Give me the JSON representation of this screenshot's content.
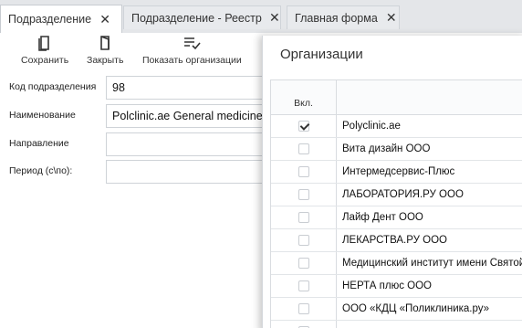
{
  "tabs": [
    {
      "label": "Подразделение",
      "active": true
    },
    {
      "label": "Подразделение - Реестр",
      "active": false
    },
    {
      "label": "Главная форма",
      "active": false
    }
  ],
  "toolbar": {
    "save_label": "Сохранить",
    "close_label": "Закрыть",
    "show_orgs_label": "Показать организации"
  },
  "form": {
    "code": {
      "label": "Код подразделения",
      "value": "98"
    },
    "name": {
      "label": "Наименование",
      "value": "Polclinic.ae General medicine"
    },
    "direction": {
      "label": "Направление",
      "value": ""
    },
    "period": {
      "label": "Период (с\\по):",
      "value": ""
    }
  },
  "dialog": {
    "title": "Организации",
    "column_incl": "Вкл.",
    "rows": [
      {
        "name": "Polyclinic.ae",
        "checked": true
      },
      {
        "name": "Вита дизайн ООО",
        "checked": false
      },
      {
        "name": "Интермедсервис-Плюс",
        "checked": false
      },
      {
        "name": "ЛАБОРАТОРИЯ.РУ ООО",
        "checked": false
      },
      {
        "name": "Лайф Дент ООО",
        "checked": false
      },
      {
        "name": "ЛЕКАРСТВА.РУ ООО",
        "checked": false
      },
      {
        "name": "Медицинский институт имени Святой Анны",
        "checked": false
      },
      {
        "name": "НЕРТА плюс ООО",
        "checked": false
      },
      {
        "name": "ООО «КДЦ «Поликлиника.ру»",
        "checked": false
      },
      {
        "name": "",
        "checked": false
      }
    ]
  },
  "icons": {
    "save": "save-icon",
    "close": "close-doc-icon",
    "show_orgs": "list-check-icon",
    "tab_close": "close-icon"
  }
}
